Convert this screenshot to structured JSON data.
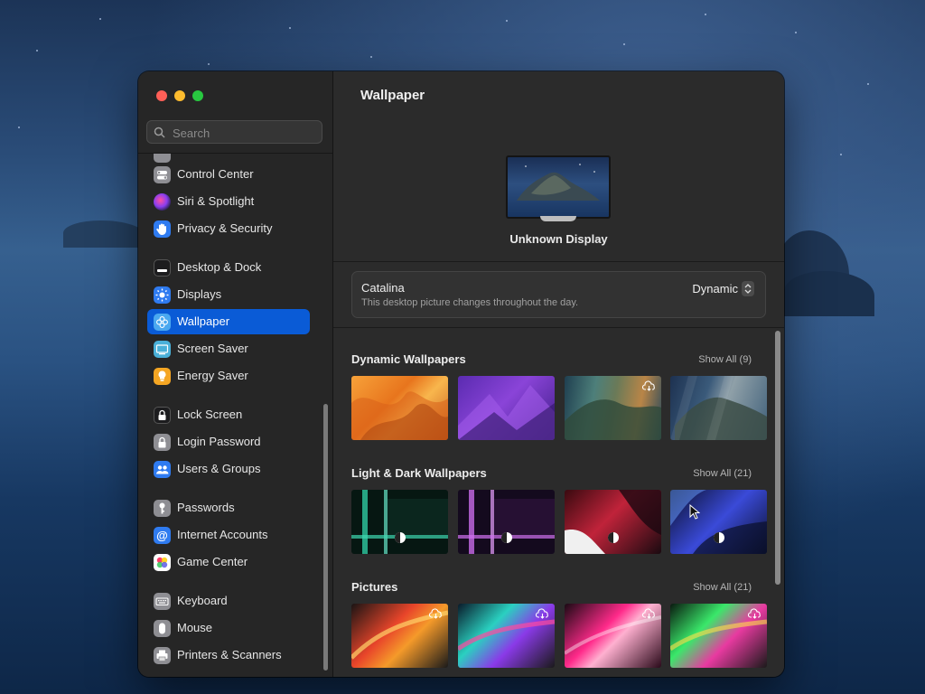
{
  "sidebar": {
    "search_placeholder": "Search",
    "items": [
      {
        "id": "control-center",
        "label": "Control Center",
        "icon": "control-center-icon",
        "color": "#8e8e93"
      },
      {
        "id": "siri-spotlight",
        "label": "Siri & Spotlight",
        "icon": "siri-icon",
        "color": "#6f4bd8"
      },
      {
        "id": "privacy-security",
        "label": "Privacy & Security",
        "icon": "hand-icon",
        "color": "#2f7bf0"
      },
      {
        "id": "desktop-dock",
        "label": "Desktop & Dock",
        "icon": "dock-icon",
        "color": "#2c2c2e"
      },
      {
        "id": "displays",
        "label": "Displays",
        "icon": "sun-icon",
        "color": "#2f7bf0"
      },
      {
        "id": "wallpaper",
        "label": "Wallpaper",
        "icon": "flower-icon",
        "color": "#4aa8f0",
        "selected": true
      },
      {
        "id": "screen-saver",
        "label": "Screen Saver",
        "icon": "screen-saver-icon",
        "color": "#4ab0d8"
      },
      {
        "id": "energy-saver",
        "label": "Energy Saver",
        "icon": "bulb-icon",
        "color": "#f5a623"
      },
      {
        "id": "lock-screen",
        "label": "Lock Screen",
        "icon": "lock-icon",
        "color": "#2c2c2e"
      },
      {
        "id": "login-password",
        "label": "Login Password",
        "icon": "padlock-icon",
        "color": "#8e8e93"
      },
      {
        "id": "users-groups",
        "label": "Users & Groups",
        "icon": "users-icon",
        "color": "#2f7bf0"
      },
      {
        "id": "passwords",
        "label": "Passwords",
        "icon": "key-icon",
        "color": "#8e8e93"
      },
      {
        "id": "internet-accounts",
        "label": "Internet Accounts",
        "icon": "at-icon",
        "color": "#2f7bf0"
      },
      {
        "id": "game-center",
        "label": "Game Center",
        "icon": "game-center-icon",
        "color": "#ffffff"
      },
      {
        "id": "keyboard",
        "label": "Keyboard",
        "icon": "keyboard-icon",
        "color": "#8e8e93"
      },
      {
        "id": "mouse",
        "label": "Mouse",
        "icon": "mouse-icon",
        "color": "#8e8e93"
      },
      {
        "id": "printers-scanners",
        "label": "Printers & Scanners",
        "icon": "printer-icon",
        "color": "#8e8e93"
      }
    ]
  },
  "main": {
    "title": "Wallpaper",
    "display_name": "Unknown Display",
    "current": {
      "name": "Catalina",
      "description": "This desktop picture changes throughout the day.",
      "mode": "Dynamic"
    },
    "sections": [
      {
        "id": "dynamic",
        "title": "Dynamic Wallpapers",
        "show_all": "Show All (9)"
      },
      {
        "id": "light-dark",
        "title": "Light & Dark Wallpapers",
        "show_all": "Show All (21)"
      },
      {
        "id": "pictures",
        "title": "Pictures",
        "show_all": "Show All (21)"
      }
    ]
  },
  "colors": {
    "accent": "#0a5bd6",
    "close": "#ff5f57",
    "minimize": "#febc2e",
    "zoom": "#28c840"
  }
}
